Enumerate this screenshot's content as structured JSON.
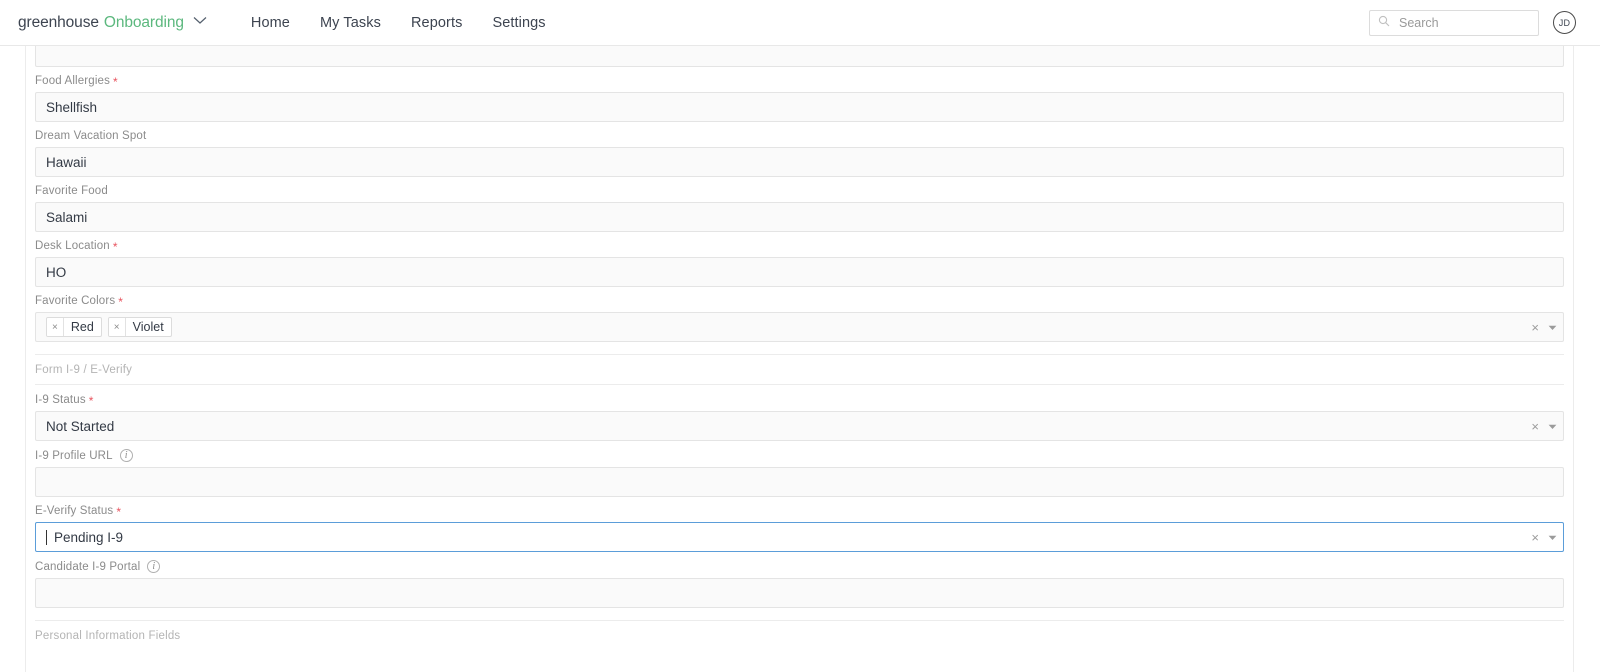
{
  "topbar": {
    "brand_primary": "greenhouse",
    "brand_product": "Onboarding",
    "brand_caret_icon": "chevron-down-icon",
    "nav": [
      {
        "label": "Home"
      },
      {
        "label": "My Tasks"
      },
      {
        "label": "Reports"
      },
      {
        "label": "Settings"
      }
    ],
    "search": {
      "icon": "search-icon",
      "placeholder": "Search",
      "value": ""
    },
    "avatar_initials": "JD"
  },
  "form": {
    "partial_top_field": {
      "value": ""
    },
    "fields": [
      {
        "label": "Food Allergies",
        "required": true,
        "value": "Shellfish",
        "type": "text"
      },
      {
        "label": "Dream Vacation Spot",
        "required": false,
        "value": "Hawaii",
        "type": "text"
      },
      {
        "label": "Favorite Food",
        "required": false,
        "value": "Salami",
        "type": "text"
      },
      {
        "label": "Desk Location",
        "required": true,
        "value": "HO",
        "type": "text"
      }
    ],
    "favorite_colors": {
      "label": "Favorite Colors",
      "required": true,
      "tags": [
        "Red",
        "Violet"
      ],
      "clear_icon": "close-icon",
      "dropdown_icon": "chevron-down-icon"
    },
    "section_i9": {
      "title": "Form I-9 / E-Verify"
    },
    "i9_status": {
      "label": "I-9 Status",
      "required": true,
      "value": "Not Started",
      "clear_icon": "close-icon",
      "dropdown_icon": "chevron-down-icon"
    },
    "i9_profile_url": {
      "label": "I-9 Profile URL",
      "required": false,
      "info_icon": "info-icon",
      "value": ""
    },
    "everify_status": {
      "label": "E-Verify Status",
      "required": true,
      "value": "Pending I-9",
      "focused": true,
      "clear_icon": "close-icon",
      "dropdown_icon": "chevron-down-icon"
    },
    "candidate_i9_portal": {
      "label": "Candidate I-9 Portal",
      "required": false,
      "info_icon": "info-icon",
      "value": ""
    },
    "section_personal": {
      "title": "Personal Information Fields"
    }
  },
  "colors": {
    "brand_green": "#5cb87e",
    "required_red": "#e8545f",
    "focus_blue": "#5b9dd9",
    "field_bg": "#fafafa",
    "label_gray": "#8b8b8b"
  }
}
